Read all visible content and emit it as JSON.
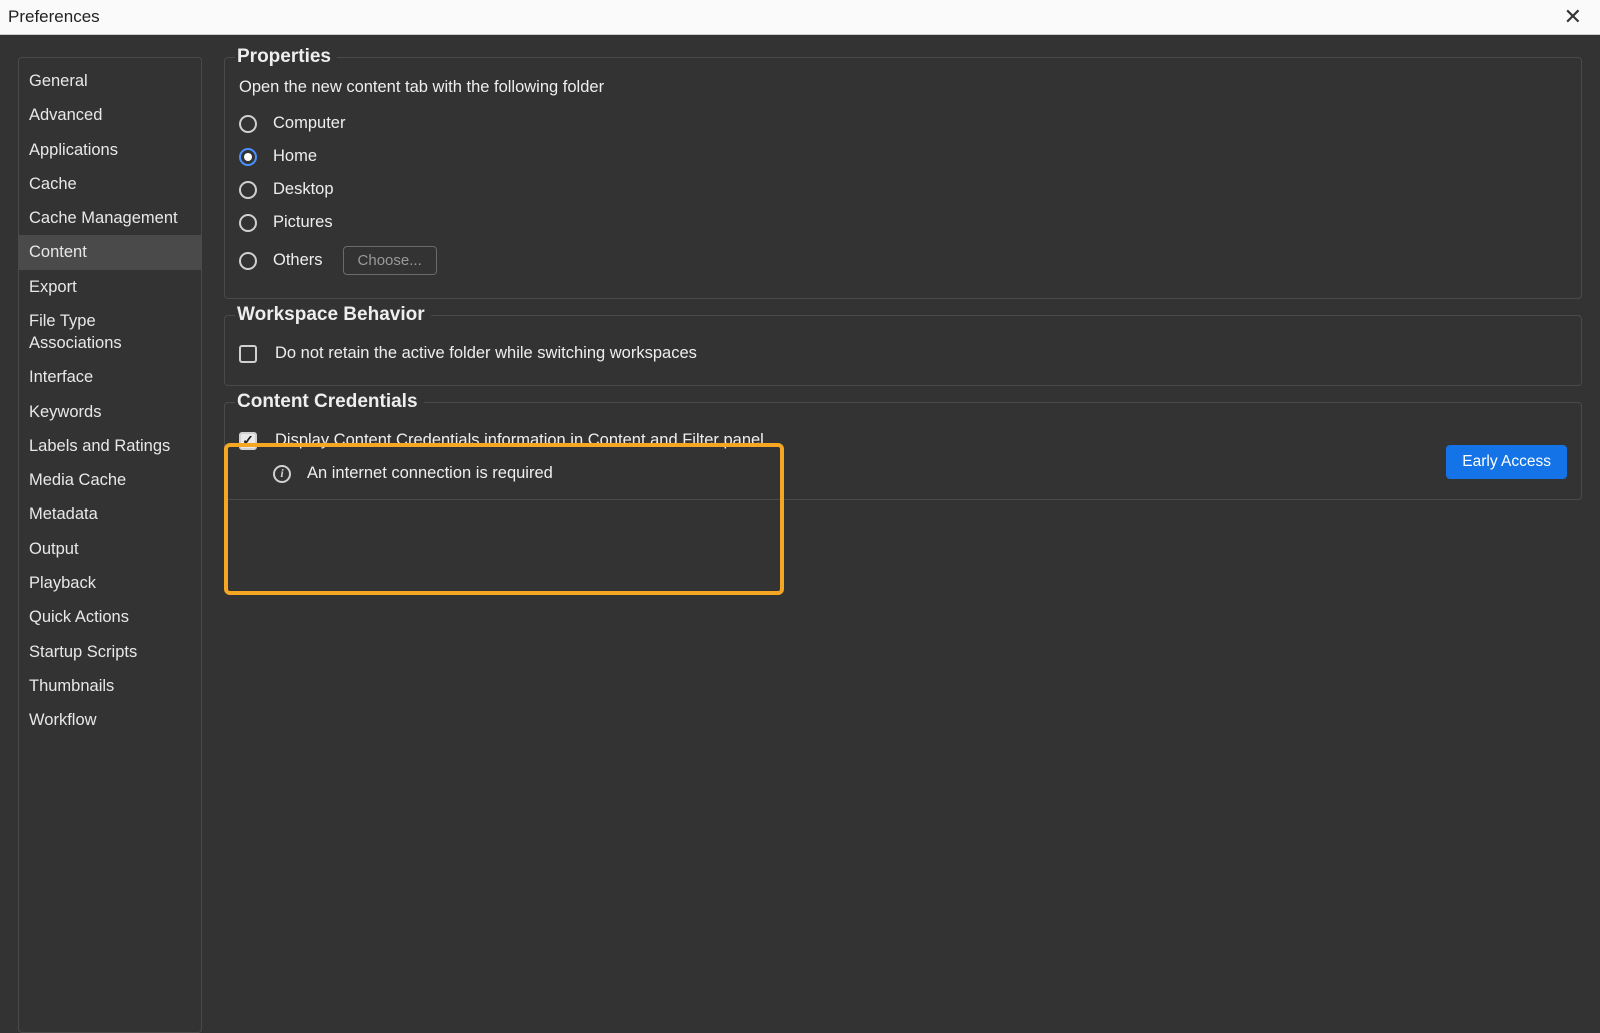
{
  "window": {
    "title": "Preferences"
  },
  "sidebar": {
    "items": [
      "General",
      "Advanced",
      "Applications",
      "Cache",
      "Cache Management",
      "Content",
      "Export",
      "File Type Associations",
      "Interface",
      "Keywords",
      "Labels and Ratings",
      "Media Cache",
      "Metadata",
      "Output",
      "Playback",
      "Quick Actions",
      "Startup Scripts",
      "Thumbnails",
      "Workflow"
    ],
    "selected_index": 5
  },
  "properties": {
    "title": "Properties",
    "description": "Open the new content tab with the following folder",
    "options": [
      "Computer",
      "Home",
      "Desktop",
      "Pictures",
      "Others"
    ],
    "selected_index": 1,
    "choose_button": "Choose..."
  },
  "workspace": {
    "title": "Workspace Behavior",
    "checkbox_label": "Do not retain the active folder while switching workspaces",
    "checked": false
  },
  "credentials": {
    "title": "Content Credentials",
    "checkbox_label": "Display Content Credentials information in Content and Filter panel",
    "checked": true,
    "info_text": "An internet connection is required",
    "early_access": "Early Access"
  }
}
